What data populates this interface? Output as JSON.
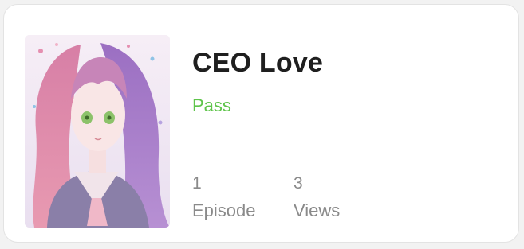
{
  "series_card": {
    "cover_image": "anime-girl-cover",
    "title": "CEO Love",
    "status": "Pass",
    "status_color": "#5ec44a",
    "episodes": {
      "value": "1",
      "label": "Episode"
    },
    "views": {
      "value": "3",
      "label": "Views"
    }
  }
}
